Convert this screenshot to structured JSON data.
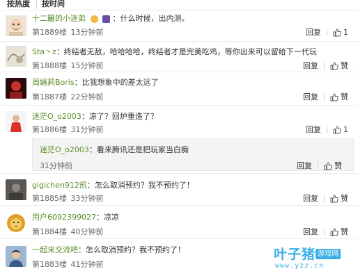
{
  "sort": {
    "hot_label": "按热度",
    "time_label": "按时间"
  },
  "comments": [
    {
      "user": "十二籬的小迷弟",
      "text": "：什么时候，出内测。",
      "floor_num": "第1889楼",
      "time": "13分钟前",
      "reply_label": "回复",
      "like_label": "",
      "like_count": "1",
      "icon": "baby-avatar"
    },
    {
      "user": "Sta丶z",
      "text": "：终结者无敌，哈哈哈哈，终结者才是完美吃鸡，等你出来可以留给下一代玩",
      "floor_num": "第1888楼",
      "time": "15分钟前",
      "reply_label": "回复",
      "like_label": "赞",
      "like_count": "",
      "icon": "sketch-avatar"
    },
    {
      "user": "周婳莉Boris",
      "text": "：比我想象中的差太远了",
      "floor_num": "第1887楼",
      "time": "22分钟前",
      "reply_label": "回复",
      "like_label": "赞",
      "like_count": "",
      "icon": "red-avatar"
    },
    {
      "user": "迷茫O_o2003",
      "text": "：凉了？回炉重造了？",
      "floor_num": "第1886楼",
      "time": "31分钟前",
      "reply_label": "回复",
      "like_label": "",
      "like_count": "1",
      "icon": "person-avatar",
      "reply": {
        "user": "迷茫O_o2003",
        "text": "：看来腾讯还是把玩家当白痴",
        "time": "31分钟前",
        "reply_label": "回复",
        "like_label": "赞"
      }
    },
    {
      "user": "gigichen912凯",
      "text": "：怎么取消预约？我不预约了！",
      "floor_num": "第1885楼",
      "time": "33分钟前",
      "reply_label": "回复",
      "like_label": "赞",
      "like_count": "",
      "icon": "dark-avatar"
    },
    {
      "user": "用户6092399027",
      "text": "：凉凉",
      "floor_num": "第1884楼",
      "time": "40分钟前",
      "reply_label": "回复",
      "like_label": "赞",
      "like_count": "",
      "icon": "lion-avatar"
    },
    {
      "user": "一起来交流吧",
      "text": "：怎么取消预约？我不预约了！",
      "floor_num": "第1883楼",
      "time": "41分钟前",
      "reply_label": "",
      "like_label": "",
      "like_count": "",
      "icon": "man-avatar"
    }
  ],
  "watermark": {
    "brand": "叶子猪",
    "tag": "游戏网",
    "url": "www.yzz.cn"
  },
  "colors": {
    "username": "#eb7350",
    "username_green": "#5a8c28",
    "watermark": "#3aaee5"
  }
}
